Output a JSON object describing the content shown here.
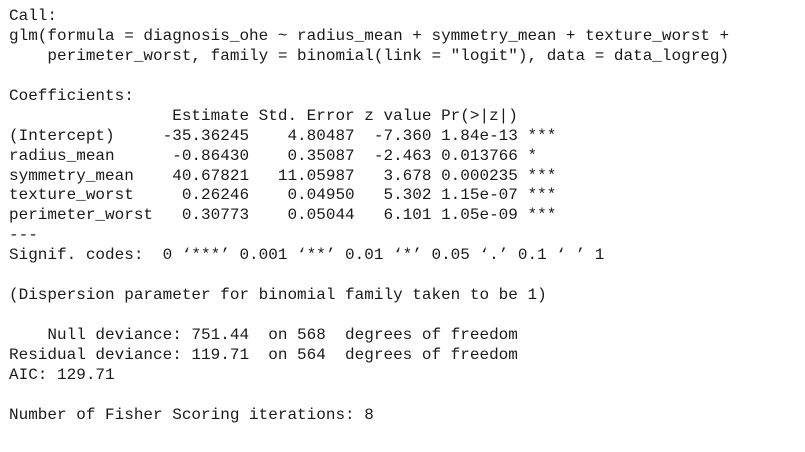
{
  "console": {
    "call_header": "Call:",
    "call_line_1": "glm(formula = diagnosis_ohe ~ radius_mean + symmetry_mean + texture_worst +",
    "call_line_2": "    perimeter_worst, family = binomial(link = \"logit\"), data = data_logreg)",
    "coefficients_header": "Coefficients:",
    "coef_table": {
      "header": "                 Estimate Std. Error z value Pr(>|z|)    ",
      "rows": [
        "(Intercept)     -35.36245    4.80487  -7.360 1.84e-13 ***",
        "radius_mean      -0.86430    0.35087  -2.463 0.013766 *  ",
        "symmetry_mean    40.67821   11.05987   3.678 0.000235 ***",
        "texture_worst     0.26246    0.04950   5.302 1.15e-07 ***",
        "perimeter_worst   0.30773    0.05044   6.101 1.05e-09 ***"
      ]
    },
    "separator": "---",
    "signif_codes": "Signif. codes:  0 ‘***’ 0.001 ‘**’ 0.01 ‘*’ 0.05 ‘.’ 0.1 ‘ ’ 1",
    "dispersion": "(Dispersion parameter for binomial family taken to be 1)",
    "null_deviance": "    Null deviance: 751.44  on 568  degrees of freedom",
    "residual_deviance": "Residual deviance: 119.71  on 564  degrees of freedom",
    "aic": "AIC: 129.71",
    "fisher_iterations": "Number of Fisher Scoring iterations: 8"
  }
}
